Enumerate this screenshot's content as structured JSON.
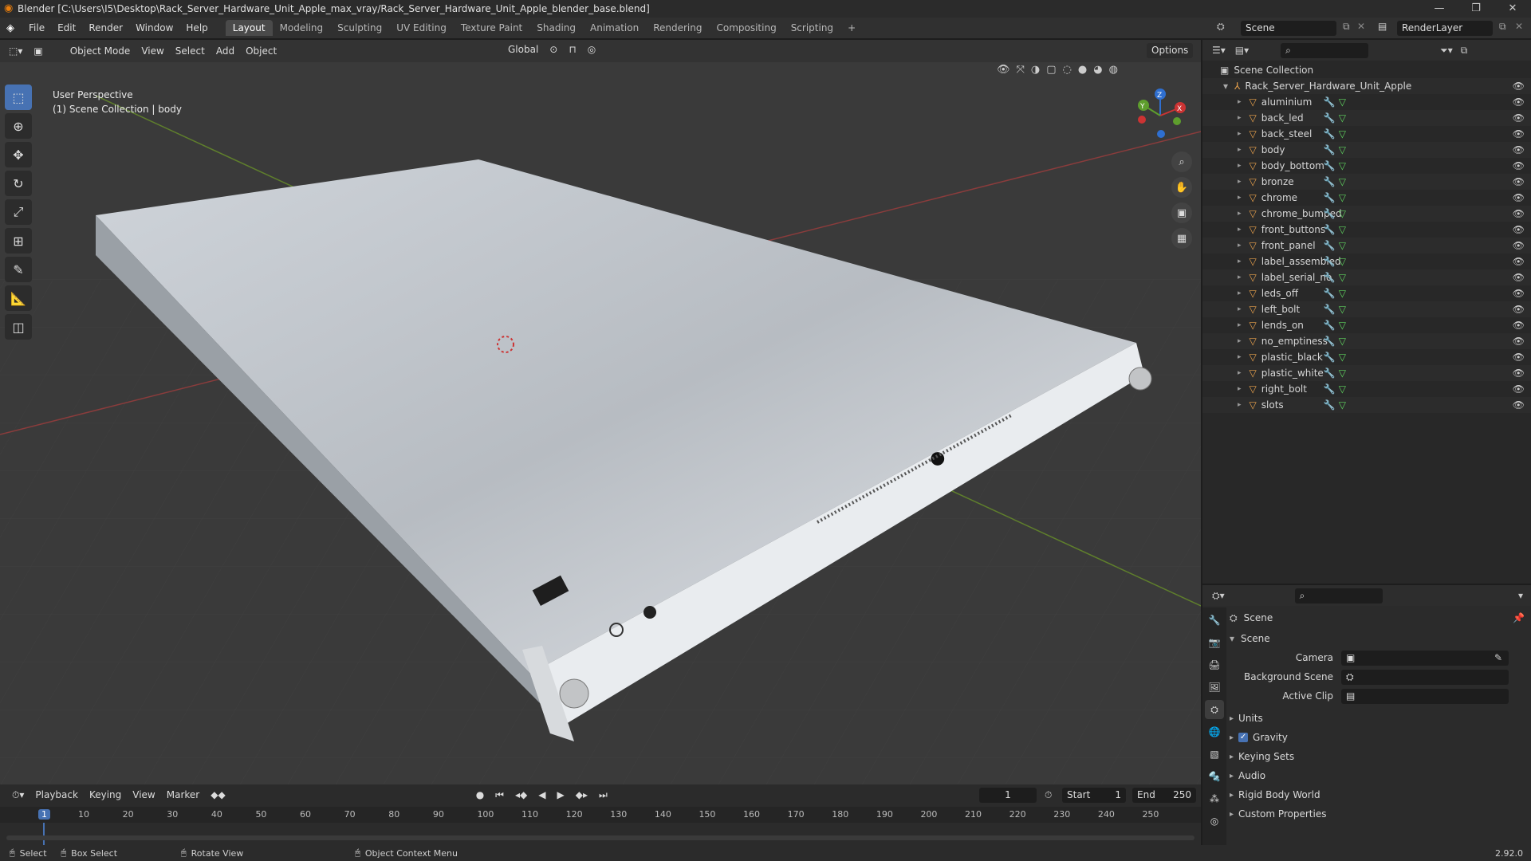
{
  "window": {
    "title": "Blender [C:\\Users\\I5\\Desktop\\Rack_Server_Hardware_Unit_Apple_max_vray/Rack_Server_Hardware_Unit_Apple_blender_base.blend]",
    "min_icon": "minimize-icon",
    "max_icon": "maximize-icon",
    "close_icon": "close-icon"
  },
  "menu": [
    "File",
    "Edit",
    "Render",
    "Window",
    "Help"
  ],
  "workspaces": [
    "Layout",
    "Modeling",
    "Sculpting",
    "UV Editing",
    "Texture Paint",
    "Shading",
    "Animation",
    "Rendering",
    "Compositing",
    "Scripting"
  ],
  "scene_field": "Scene",
  "render_layer_field": "RenderLayer",
  "viewport": {
    "mode": "Object Mode",
    "menus": [
      "View",
      "Select",
      "Add",
      "Object"
    ],
    "transform": "Global",
    "options_label": "Options",
    "overlay_title": "User Perspective",
    "overlay_sub": "(1) Scene Collection | body",
    "gizmo_x": "X",
    "gizmo_y": "Y",
    "gizmo_z": "Z"
  },
  "outliner": {
    "root": "Scene Collection",
    "collection": "Rack_Server_Hardware_Unit_Apple",
    "objects": [
      "aluminium",
      "back_led",
      "back_steel",
      "body",
      "body_bottom",
      "bronze",
      "chrome",
      "chrome_bumped",
      "front_buttons",
      "front_panel",
      "label_assembled",
      "label_serial_no",
      "leds_off",
      "left_bolt",
      "lends_on",
      "no_emptiness",
      "plastic_black",
      "plastic_white",
      "right_bolt",
      "slots"
    ]
  },
  "properties": {
    "header": "Scene",
    "section": "Scene",
    "camera_label": "Camera",
    "background_label": "Background Scene",
    "clip_label": "Active Clip",
    "panels": [
      "Units",
      "Gravity",
      "Keying Sets",
      "Audio",
      "Rigid Body World",
      "Custom Properties"
    ],
    "gravity_checked": true
  },
  "timeline": {
    "menus": [
      "Playback",
      "Keying",
      "View",
      "Marker"
    ],
    "current_frame": "1",
    "start_label": "Start",
    "start": "1",
    "end_label": "End",
    "end": "250",
    "ruler": [
      "1",
      "10",
      "20",
      "30",
      "40",
      "50",
      "60",
      "70",
      "80",
      "90",
      "100",
      "110",
      "120",
      "130",
      "140",
      "150",
      "160",
      "170",
      "180",
      "190",
      "200",
      "210",
      "220",
      "230",
      "240",
      "250"
    ]
  },
  "status": {
    "select": "Select",
    "box_select": "Box Select",
    "rotate": "Rotate View",
    "context": "Object Context Menu",
    "version": "2.92.0"
  }
}
